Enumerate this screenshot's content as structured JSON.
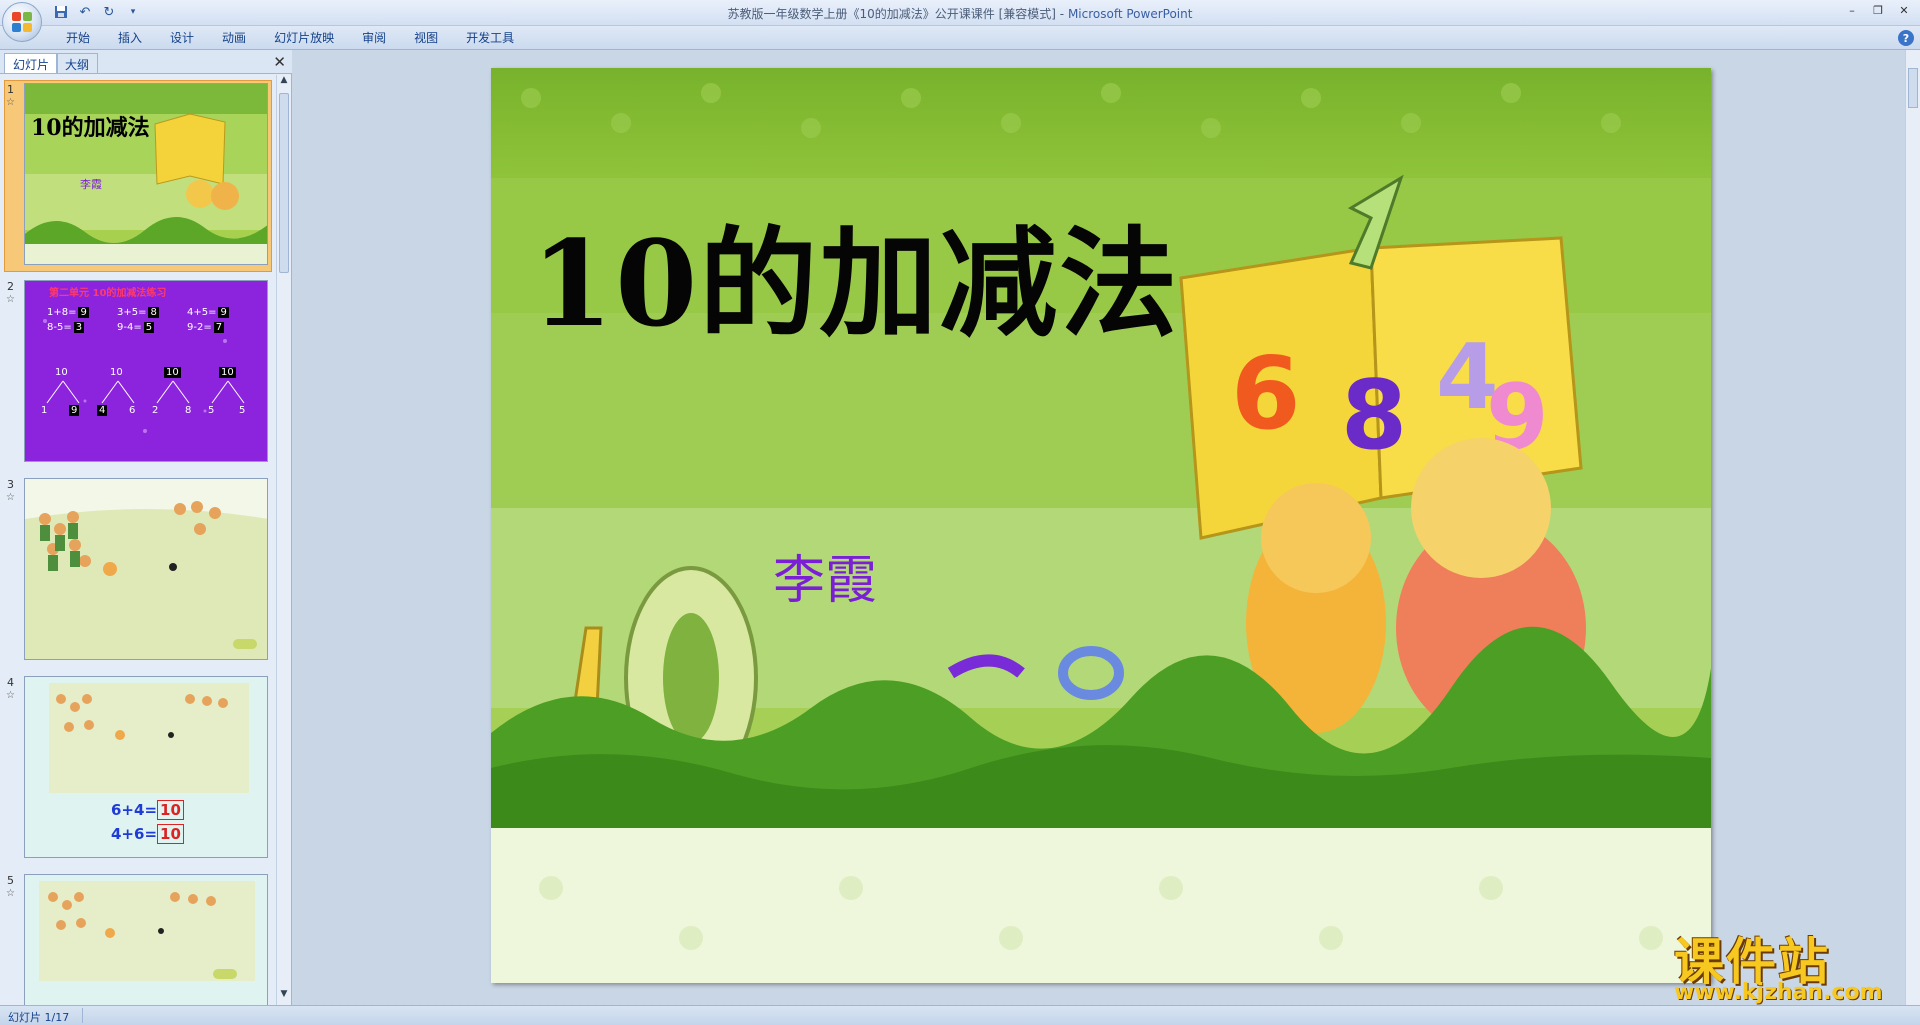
{
  "window": {
    "title": "苏教版一年级数学上册《10的加减法》公开课课件 [兼容模式] - ",
    "app_name": "Microsoft PowerPoint"
  },
  "ribbon": {
    "tabs": [
      "开始",
      "插入",
      "设计",
      "动画",
      "幻灯片放映",
      "审阅",
      "视图",
      "开发工具"
    ]
  },
  "left_pane": {
    "tabs": {
      "slides": "幻灯片",
      "outline": "大纲"
    },
    "thumbnails": [
      {
        "num": "1",
        "title": "10的加减法",
        "author": "李霞"
      },
      {
        "num": "2",
        "heading": "第二单元 10的加减法练习",
        "rows": [
          [
            "1+8=",
            "9"
          ],
          [
            "8-5=",
            "3"
          ],
          [
            "3+5=",
            "8"
          ],
          [
            "9-4=",
            "5"
          ],
          [
            "4+5=",
            "9"
          ],
          [
            "9-2=",
            "7"
          ]
        ],
        "bonds": [
          "10",
          "10",
          "10",
          "10"
        ],
        "parts": [
          "1",
          "9",
          "4",
          "6",
          "2",
          "8",
          "5",
          "5"
        ]
      },
      {
        "num": "3"
      },
      {
        "num": "4",
        "eq1": "6+4=",
        "ans1": "10",
        "eq2": "4+6=",
        "ans2": "10"
      },
      {
        "num": "5"
      }
    ]
  },
  "slide": {
    "title": "10的加减法",
    "author": "李霞"
  },
  "watermark": {
    "text": "课件站",
    "url": "www.kjzhan.com"
  },
  "status": {
    "slide_indicator": "幻灯片 1/17"
  }
}
